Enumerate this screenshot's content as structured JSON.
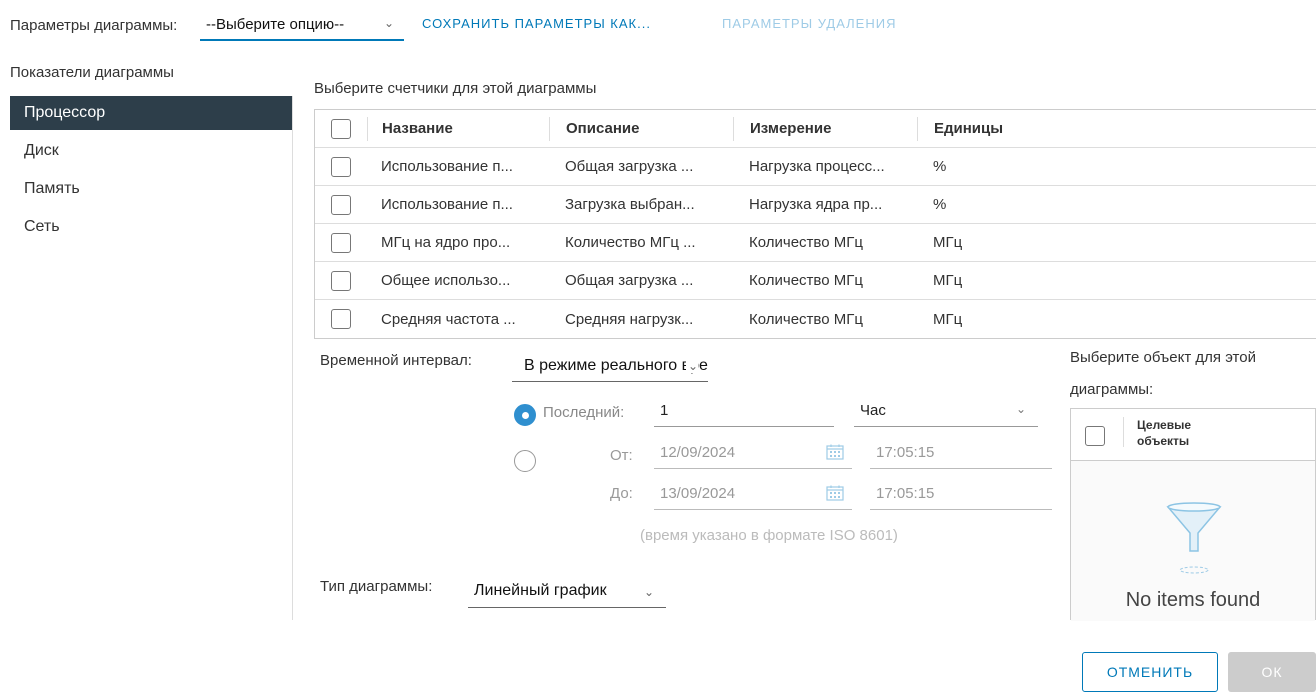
{
  "toolbar": {
    "options_label": "Параметры диаграммы:",
    "options_value": "--Выберите опцию--",
    "save_as": "СОХРАНИТЬ ПАРАМЕТРЫ КАК...",
    "delete_options": "ПАРАМЕТРЫ УДАЛЕНИЯ"
  },
  "metrics": {
    "title": "Показатели диаграммы",
    "items": [
      {
        "label": "Процессор",
        "active": true
      },
      {
        "label": "Диск",
        "active": false
      },
      {
        "label": "Память",
        "active": false
      },
      {
        "label": "Сеть",
        "active": false
      }
    ]
  },
  "counters": {
    "title": "Выберите счетчики для этой диаграммы",
    "headers": {
      "name": "Название",
      "description": "Описание",
      "measurement": "Измерение",
      "units": "Единицы"
    },
    "rows": [
      {
        "name": "Использование п...",
        "description": "Общая загрузка ...",
        "measurement": "Нагрузка процесс...",
        "units": "%",
        "checked": false
      },
      {
        "name": "Использование п...",
        "description": "Загрузка выбран...",
        "measurement": "Нагрузка ядра пр...",
        "units": "%",
        "checked": false
      },
      {
        "name": "МГц на ядро про...",
        "description": "Количество МГц ...",
        "measurement": "Количество МГц",
        "units": "МГц",
        "checked": false
      },
      {
        "name": "Общее использо...",
        "description": "Общая загрузка ...",
        "measurement": "Количество МГц",
        "units": "МГц",
        "checked": false
      },
      {
        "name": "Средняя частота ...",
        "description": "Средняя нагрузк...",
        "measurement": "Количество МГц",
        "units": "МГц",
        "checked": false
      }
    ]
  },
  "time_interval": {
    "label": "Временной интервал:",
    "value": "В режиме реального времени",
    "last_label": "Последний:",
    "last_value": "1",
    "last_unit": "Час",
    "from_label": "От:",
    "from_date": "12/09/2024",
    "from_time": "17:05:15",
    "to_label": "До:",
    "to_date": "13/09/2024",
    "to_time": "17:05:15",
    "iso_note": "(время указано в формате ISO 8601)"
  },
  "chart_type": {
    "label": "Тип диаграммы:",
    "value": "Линейный график"
  },
  "objects": {
    "title": "Выберите объект для этой диаграммы:",
    "header": "Целевые объекты",
    "empty": "No items found"
  },
  "footer": {
    "cancel": "ОТМЕНИТЬ",
    "ok": "ОК"
  },
  "colors": {
    "accent": "#0079b8",
    "active_item_bg": "#2d3e4a",
    "radio_on": "#2f8fcf",
    "disabled_btn": "#cccccc"
  }
}
